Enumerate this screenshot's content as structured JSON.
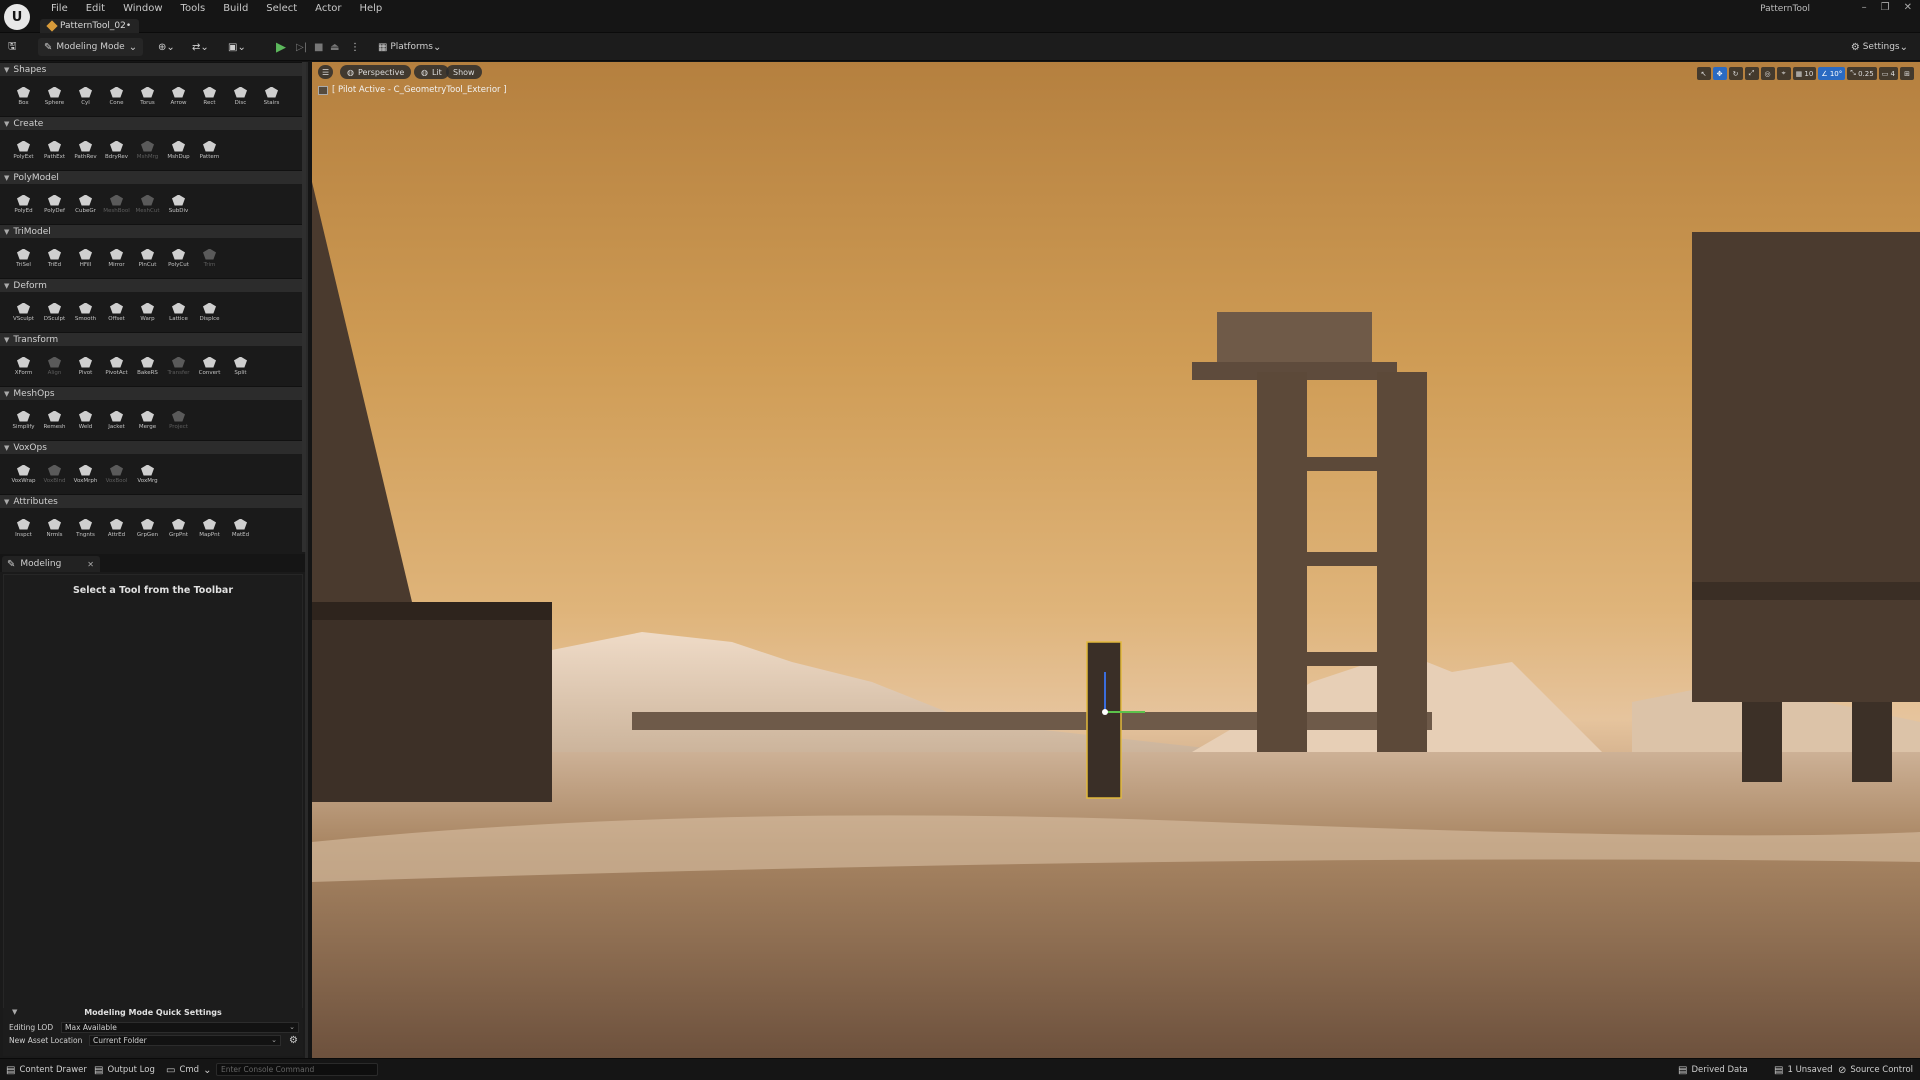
{
  "window": {
    "project_name": "PatternTool",
    "document_tab": "PatternTool_02•",
    "logo_text": "U"
  },
  "menu": [
    "File",
    "Edit",
    "Window",
    "Tools",
    "Build",
    "Select",
    "Actor",
    "Help"
  ],
  "toolbar": {
    "mode_label": "Modeling Mode",
    "platforms_label": "Platforms",
    "settings_label": "Settings"
  },
  "palette": {
    "sections": [
      {
        "title": "Shapes",
        "tools": [
          {
            "label": "Box"
          },
          {
            "label": "Sphere"
          },
          {
            "label": "Cyl"
          },
          {
            "label": "Cone"
          },
          {
            "label": "Torus"
          },
          {
            "label": "Arrow"
          },
          {
            "label": "Rect"
          },
          {
            "label": "Disc"
          },
          {
            "label": "Stairs"
          }
        ]
      },
      {
        "title": "Create",
        "tools": [
          {
            "label": "PolyExt"
          },
          {
            "label": "PathExt"
          },
          {
            "label": "PathRev"
          },
          {
            "label": "BdryRev"
          },
          {
            "label": "MshMrg",
            "dim": true
          },
          {
            "label": "MshDup"
          },
          {
            "label": "Pattern"
          }
        ]
      },
      {
        "title": "PolyModel",
        "tools": [
          {
            "label": "PolyEd"
          },
          {
            "label": "PolyDef"
          },
          {
            "label": "CubeGr"
          },
          {
            "label": "MeshBool",
            "dim": true
          },
          {
            "label": "MeshCut",
            "dim": true
          },
          {
            "label": "SubDiv"
          }
        ]
      },
      {
        "title": "TriModel",
        "tools": [
          {
            "label": "TriSel"
          },
          {
            "label": "TriEd"
          },
          {
            "label": "HFill"
          },
          {
            "label": "Mirror"
          },
          {
            "label": "PlnCut"
          },
          {
            "label": "PolyCut"
          },
          {
            "label": "Trim",
            "dim": true
          }
        ]
      },
      {
        "title": "Deform",
        "tools": [
          {
            "label": "VSculpt"
          },
          {
            "label": "DSculpt"
          },
          {
            "label": "Smooth"
          },
          {
            "label": "Offset"
          },
          {
            "label": "Warp"
          },
          {
            "label": "Lattice"
          },
          {
            "label": "Displce"
          }
        ]
      },
      {
        "title": "Transform",
        "tools": [
          {
            "label": "XForm"
          },
          {
            "label": "Align",
            "dim": true
          },
          {
            "label": "Pivot"
          },
          {
            "label": "PivotAct"
          },
          {
            "label": "BakeRS"
          },
          {
            "label": "Transfer",
            "dim": true
          },
          {
            "label": "Convert"
          },
          {
            "label": "Split"
          }
        ]
      },
      {
        "title": "MeshOps",
        "tools": [
          {
            "label": "Simplify"
          },
          {
            "label": "Remesh"
          },
          {
            "label": "Weld"
          },
          {
            "label": "Jacket"
          },
          {
            "label": "Merge"
          },
          {
            "label": "Project",
            "dim": true
          }
        ]
      },
      {
        "title": "VoxOps",
        "tools": [
          {
            "label": "VoxWrap"
          },
          {
            "label": "VoxBlnd",
            "dim": true
          },
          {
            "label": "VoxMrph"
          },
          {
            "label": "VoxBool",
            "dim": true
          },
          {
            "label": "VoxMrg"
          }
        ]
      },
      {
        "title": "Attributes",
        "tools": [
          {
            "label": "Inspct"
          },
          {
            "label": "Nrmls"
          },
          {
            "label": "Tngnts"
          },
          {
            "label": "AttrEd"
          },
          {
            "label": "GrpGen"
          },
          {
            "label": "GrpPnt"
          },
          {
            "label": "MapPnt"
          },
          {
            "label": "MatEd"
          }
        ]
      }
    ]
  },
  "modeling_panel": {
    "tab_label": "Modeling",
    "hint": "Select a Tool from the Toolbar",
    "quick_settings_title": "Modeling Mode Quick Settings",
    "editing_lod_label": "Editing LOD",
    "editing_lod_value": "Max Available",
    "asset_location_label": "New Asset Location",
    "asset_location_value": "Current Folder"
  },
  "viewport": {
    "perspective_label": "Perspective",
    "lit_label": "Lit",
    "show_label": "Show",
    "pilot_label": "[ Pilot Active - C_GeometryTool_Exterior ]",
    "grid_snap": "10",
    "rotation_snap": "10°",
    "scale_snap": "0.25",
    "camera_speed": "4"
  },
  "statusbar": {
    "content_drawer": "Content Drawer",
    "output_log": "Output Log",
    "cmd": "Cmd",
    "console_placeholder": "Enter Console Command",
    "derived_data": "Derived Data",
    "unsaved": "1 Unsaved",
    "source_control": "Source Control"
  }
}
